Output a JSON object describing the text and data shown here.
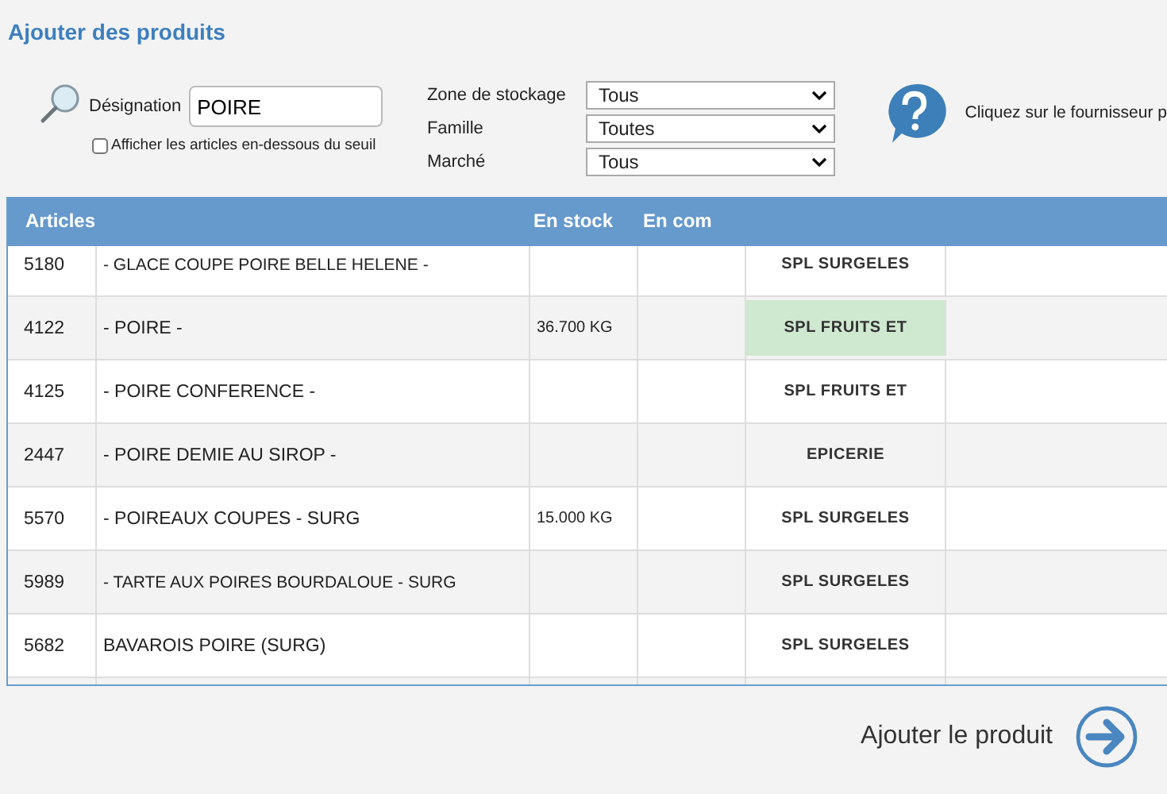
{
  "title": "Ajouter des produits",
  "search": {
    "label": "Désignation",
    "value": "POIRE"
  },
  "threshold_checkbox": {
    "label": "Afficher les articles en-dessous du seuil",
    "checked": false
  },
  "filters": [
    {
      "label": "Zone de stockage",
      "value": "Tous"
    },
    {
      "label": "Famille",
      "value": "Toutes"
    },
    {
      "label": "Marché",
      "value": "Tous"
    }
  ],
  "help_text": "Cliquez sur le fournisseur p",
  "table": {
    "columns": [
      "Articles",
      "En stock",
      "En com"
    ],
    "rows": [
      {
        "code": "5180",
        "name": "- GLACE COUPE POIRE BELLE HELENE -",
        "stock": "",
        "supplier": "SPL SURGELES",
        "highlighted": false
      },
      {
        "code": "4122",
        "name": "- POIRE -",
        "stock": "36.700 KG",
        "supplier": "SPL FRUITS ET",
        "highlighted": true
      },
      {
        "code": "4125",
        "name": "- POIRE CONFERENCE -",
        "stock": "",
        "supplier": "SPL FRUITS ET",
        "highlighted": false
      },
      {
        "code": "2447",
        "name": "- POIRE DEMIE AU SIROP -",
        "stock": "",
        "supplier": "EPICERIE",
        "highlighted": false
      },
      {
        "code": "5570",
        "name": "- POIREAUX COUPES - SURG",
        "stock": "15.000 KG",
        "supplier": "SPL SURGELES",
        "highlighted": false
      },
      {
        "code": "5989",
        "name": "- TARTE AUX POIRES BOURDALOUE - SURG",
        "stock": "",
        "supplier": "SPL SURGELES",
        "highlighted": false
      },
      {
        "code": "5682",
        "name": "BAVAROIS POIRE (SURG)",
        "stock": "",
        "supplier": "SPL SURGELES",
        "highlighted": false
      }
    ]
  },
  "add_button": "Ajouter le produit"
}
